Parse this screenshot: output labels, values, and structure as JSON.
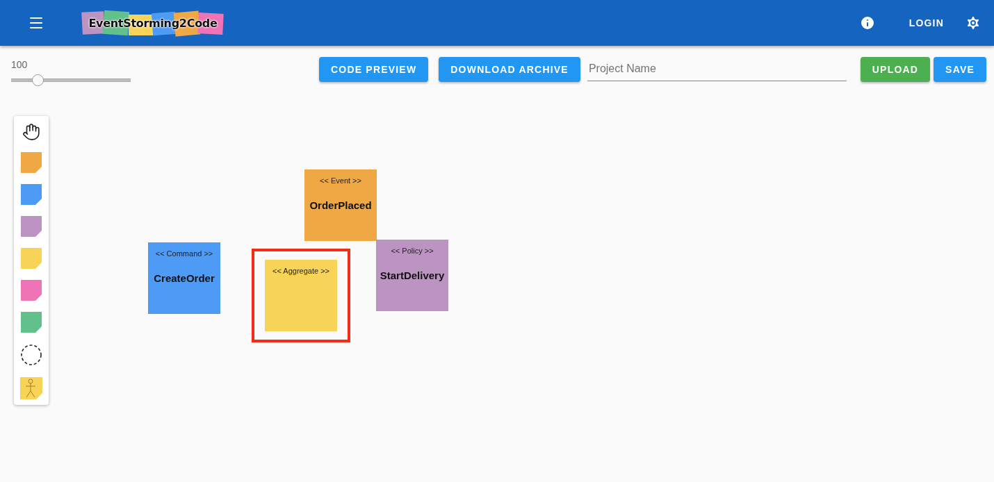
{
  "app_bar": {
    "logo": "EventStorming2Code",
    "login": "LOGIN"
  },
  "toolbar": {
    "zoom": {
      "reading": "100",
      "level": 0.22
    },
    "buttons": [
      {
        "label": "CODE PREVIEW"
      },
      {
        "label": "DOWNLOAD ARCHIVE"
      }
    ],
    "project_name": {
      "placeholder": "Project Name"
    },
    "actions": [
      {
        "label": "UPLOAD",
        "kind": "success"
      },
      {
        "label": "SAVE",
        "kind": "primary"
      }
    ]
  },
  "palette": [
    {
      "kind": "hand"
    },
    {
      "kind": "sticky",
      "color": "#f0a845"
    },
    {
      "kind": "sticky",
      "color": "#4e9bf5"
    },
    {
      "kind": "sticky",
      "color": "#bb94c1"
    },
    {
      "kind": "sticky",
      "color": "#f7d457"
    },
    {
      "kind": "sticky",
      "color": "#ef74b7"
    },
    {
      "kind": "sticky",
      "color": "#62c08a"
    },
    {
      "kind": "boundary"
    },
    {
      "kind": "actor"
    }
  ],
  "stickies": [
    {
      "stereotype": "<< Event >>",
      "name": "OrderPlaced",
      "color": "#f0a845",
      "highlighted": false
    },
    {
      "stereotype": "<< Command >>",
      "name": "CreateOrder",
      "color": "#4e9bf5",
      "highlighted": false
    },
    {
      "stereotype": "<< Aggregate >>",
      "color": "#f7d457",
      "highlighted": true
    },
    {
      "stereotype": "<< Policy >>",
      "name": "StartDelivery",
      "color": "#bb94c1",
      "highlighted": false
    }
  ]
}
